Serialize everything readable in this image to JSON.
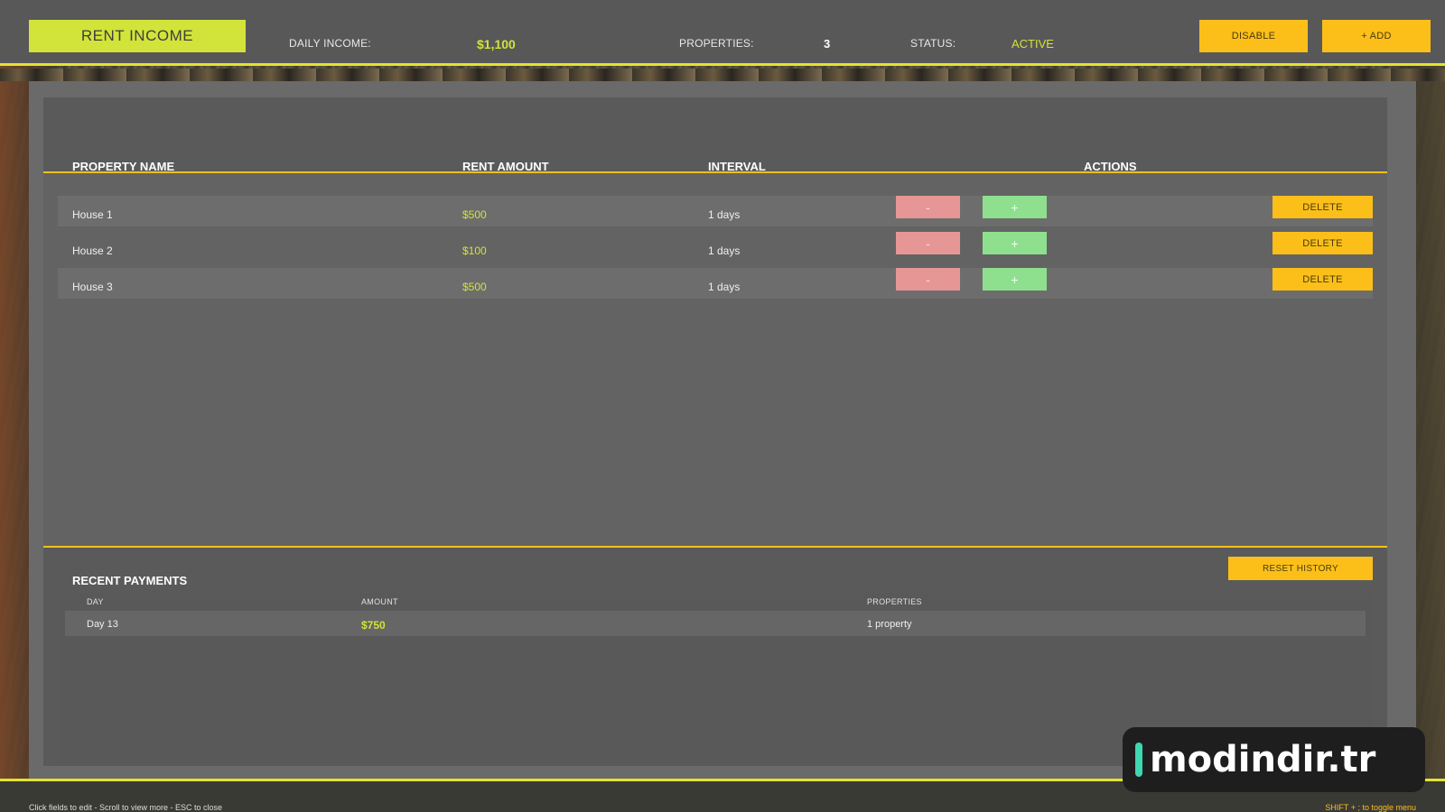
{
  "header": {
    "title": "RENT INCOME",
    "daily_income_label": "DAILY INCOME:",
    "daily_income_value": "$1,100",
    "properties_label": "PROPERTIES:",
    "properties_value": "3",
    "status_label": "STATUS:",
    "status_value": "ACTIVE",
    "disable_label": "DISABLE",
    "add_label": "+ ADD"
  },
  "properties_table": {
    "columns": [
      "PROPERTY NAME",
      "RENT AMOUNT",
      "INTERVAL",
      "ACTIONS"
    ],
    "rows": [
      {
        "name": "House 1",
        "amount": "$500",
        "interval": "1 days",
        "minus": "-",
        "plus": "+",
        "delete": "DELETE"
      },
      {
        "name": "House 2",
        "amount": "$100",
        "interval": "1 days",
        "minus": "-",
        "plus": "+",
        "delete": "DELETE"
      },
      {
        "name": "House 3",
        "amount": "$500",
        "interval": "1 days",
        "minus": "-",
        "plus": "+",
        "delete": "DELETE"
      }
    ]
  },
  "payments": {
    "title": "RECENT PAYMENTS",
    "reset_label": "RESET HISTORY",
    "columns": [
      "DAY",
      "AMOUNT",
      "PROPERTIES"
    ],
    "rows": [
      {
        "day": "Day 13",
        "amount": "$750",
        "properties": "1 property"
      }
    ]
  },
  "footer": {
    "hint_left": "Click fields to edit - Scroll to view more - ESC to close",
    "hint_right": "SHIFT + ; to toggle menu"
  },
  "watermark": {
    "text": "modindir.tr"
  },
  "colors": {
    "accent_yellow": "#fcbf1a",
    "accent_lime": "#d2e33a",
    "minus_red": "#e79696",
    "plus_green": "#8ee08e"
  }
}
